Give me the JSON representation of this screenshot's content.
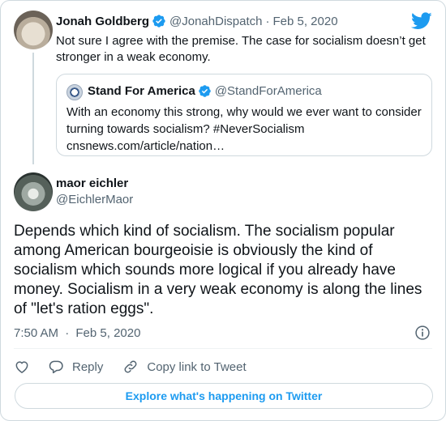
{
  "parent_tweet": {
    "name": "Jonah Goldberg",
    "handle": "@JonahDispatch",
    "separator": "·",
    "date": "Feb 5, 2020",
    "text": "Not sure I agree with the premise. The case for socialism doesn’t get stronger in a weak economy."
  },
  "quoted_tweet": {
    "name": "Stand For America",
    "handle": "@StandForAmerica",
    "text_line1": "With an economy this strong, why would we ever want to consider",
    "text_line2": "turning towards socialism? #NeverSocialism",
    "link": "cnsnews.com/article/nation…"
  },
  "main_tweet": {
    "name": "maor eichler",
    "handle": "@EichlerMaor",
    "text": "Depends which kind of socialism. The socialism popular among American bourgeoisie is obviously the kind of socialism which sounds more logical if you already have money. Socialism in a very weak economy is along the lines of \"let's ration eggs\".",
    "time": "7:50 AM",
    "separator": "·",
    "date": "Feb 5, 2020"
  },
  "actions": {
    "reply_label": "Reply",
    "copy_label": "Copy link to Tweet"
  },
  "explore_label": "Explore what's happening on Twitter",
  "colors": {
    "accent": "#1d9bf0",
    "muted": "#536471",
    "border": "#cfd9de"
  },
  "icons": [
    "twitter-bird-icon",
    "verified-badge-icon",
    "info-icon",
    "heart-icon",
    "reply-icon",
    "link-icon"
  ]
}
